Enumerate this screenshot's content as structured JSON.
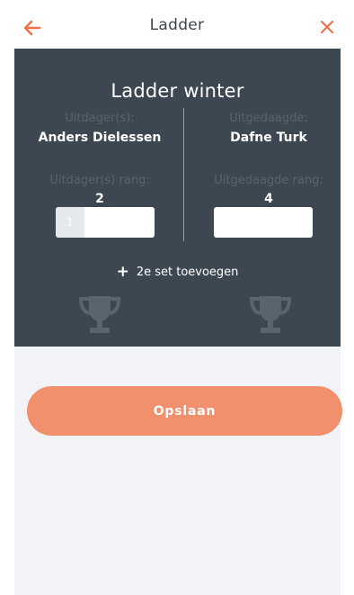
{
  "header": {
    "title": "Ladder",
    "back_icon": "arrow-left-icon",
    "close_icon": "close-icon",
    "accent_color": "#f0714a"
  },
  "match": {
    "ladder_name": "Ladder winter",
    "challenger": {
      "label": "Uitdager(s):",
      "name": "Anders Dielessen",
      "rank_label": "Uitdager(s) rang:",
      "rank": "2",
      "score_prefix": "1",
      "score_value": ""
    },
    "challenged": {
      "label": "Uitgedaagde:",
      "name": "Dafne Turk",
      "rank_label": "Uitgedaagde rang:",
      "rank": "4",
      "score_value": ""
    },
    "add_set_label": "2e set toevoegen",
    "trophy_icon": "trophy-icon"
  },
  "actions": {
    "save_label": "Opslaan",
    "save_color": "#f0906c"
  },
  "colors": {
    "panel": "#3d4752",
    "muted_text": "#59636e",
    "page_bg": "#f2f3f6"
  }
}
